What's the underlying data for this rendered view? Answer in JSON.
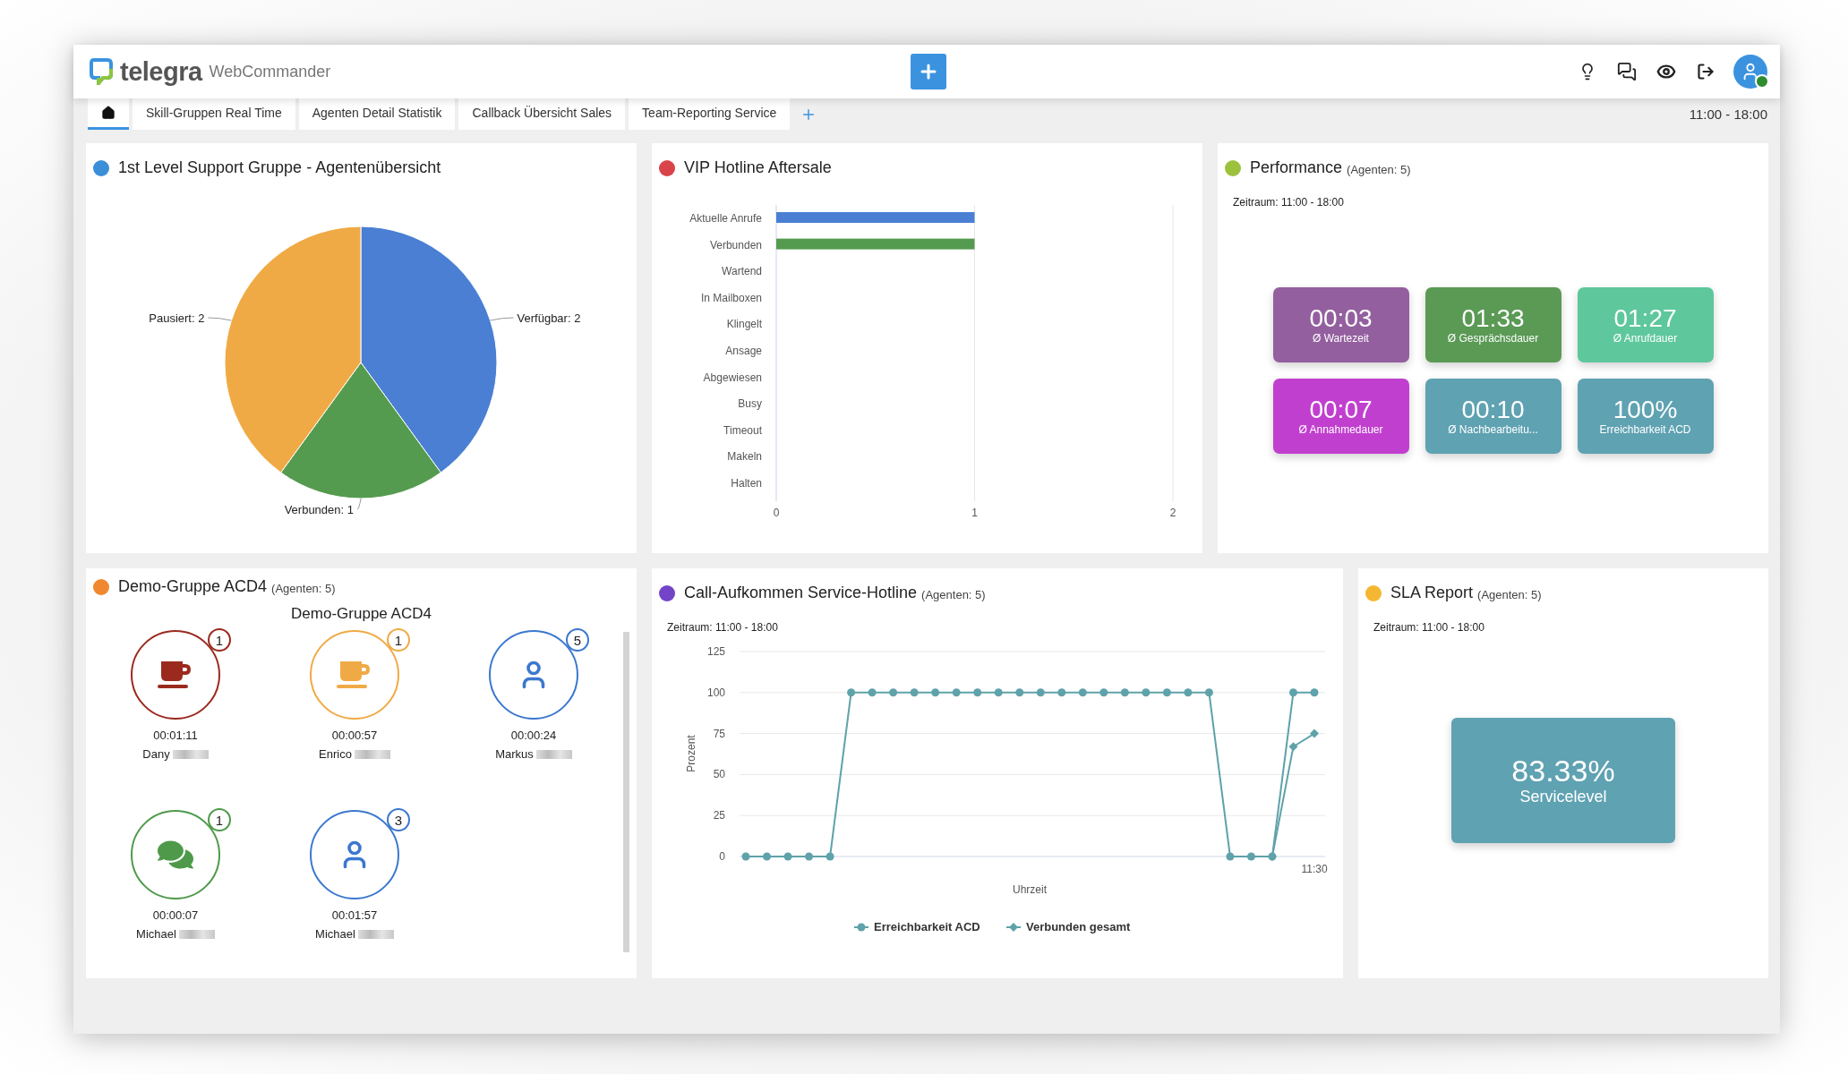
{
  "app": {
    "logo_text": "telegra",
    "product": "WebCommander"
  },
  "tabs": [
    {
      "kind": "home",
      "selected": true
    },
    {
      "kind": "text",
      "label": "Skill-Gruppen Real Time",
      "selected": false
    },
    {
      "kind": "text",
      "label": "Agenten Detail Statistik",
      "selected": false
    },
    {
      "kind": "text",
      "label": "Callback Übersicht Sales",
      "selected": false
    },
    {
      "kind": "text",
      "label": "Team-Reporting Service",
      "selected": false
    }
  ],
  "time_range": "11:00 - 18:00",
  "panels": [
    {
      "kind": "pie",
      "title": "1st Level Support Gruppe - Agentenübersicht",
      "color": "#3a8fd8",
      "chart_data": {
        "type": "pie",
        "categories": [
          "Verfügbar: 2",
          "Verbunden: 1",
          "Pausiert: 2"
        ],
        "values": [
          2,
          1,
          2
        ],
        "colors": [
          "#4a7fd4",
          "#559b4f",
          "#f0aa45"
        ]
      }
    },
    {
      "kind": "bar",
      "title": "VIP Hotline Aftersale",
      "color": "#d9434a",
      "chart_data": {
        "type": "bar",
        "orientation": "horizontal",
        "categories": [
          "Aktuelle Anrufe",
          "Verbunden",
          "Wartend",
          "In Mailboxen",
          "Klingelt",
          "Ansage",
          "Abgewiesen",
          "Busy",
          "Timeout",
          "Makeln",
          "Halten"
        ],
        "series": [
          {
            "color": "#4a7fd4",
            "values": [
              1,
              0,
              0,
              0,
              0,
              0,
              0,
              0,
              0,
              0,
              0
            ]
          },
          {
            "color": "#559b4f",
            "values": [
              0,
              1,
              0,
              0,
              0,
              0,
              0,
              0,
              0,
              0,
              0
            ]
          }
        ],
        "xlim": [
          0,
          2
        ],
        "xticks": [
          0,
          1,
          2
        ],
        "grid": true
      }
    },
    {
      "kind": "performance",
      "title": "Performance",
      "subtitle": "(Agenten: 5)",
      "color": "#9cc13c",
      "period": "Zeitraum: 11:00 - 18:00",
      "tiles": [
        {
          "value": "00:03",
          "label": "Ø Wartezeit",
          "color": "#945f9f"
        },
        {
          "value": "01:33",
          "label": "Ø Gesprächsdauer",
          "color": "#5a9a55"
        },
        {
          "value": "01:27",
          "label": "Ø Anrufdauer",
          "color": "#5ec79c"
        },
        {
          "value": "00:07",
          "label": "Ø Annahmedauer",
          "color": "#c13fcf"
        },
        {
          "value": "00:10",
          "label": "Ø Nachbearbeitu...",
          "color": "#5fa2b2"
        },
        {
          "value": "100%",
          "label": "Erreichbarkeit ACD",
          "color": "#5fa2b2"
        }
      ]
    },
    {
      "kind": "agents",
      "title": "Demo-Gruppe ACD4",
      "subtitle": "(Agenten: 5)",
      "color": "#f0882f",
      "group_heading": "Demo-Gruppe ACD4",
      "agent_rows": [
        {
          "agents": [
            {
              "kind": "cup",
              "color": "#9b2a1e",
              "count": "1",
              "time": "00:01:11",
              "name": "Dany"
            },
            {
              "kind": "cup",
              "color": "#f0aa45",
              "count": "1",
              "time": "00:00:57",
              "name": "Enrico"
            },
            {
              "kind": "person",
              "color": "#3b78cf",
              "count": "5",
              "time": "00:00:24",
              "name": "Markus"
            }
          ]
        },
        {
          "agents": [
            {
              "kind": "chat",
              "color": "#4e9a4a",
              "count": "1",
              "time": "00:00:07",
              "name": "Michael"
            },
            {
              "kind": "person",
              "color": "#3b78cf",
              "count": "3",
              "time": "00:01:57",
              "name": "Michael"
            }
          ]
        }
      ]
    },
    {
      "kind": "line",
      "title": "Call-Aufkommen Service-Hotline",
      "subtitle": "(Agenten: 5)",
      "color": "#7444c8",
      "period": "Zeitraum: 11:00 - 18:00",
      "time_label": "11:30",
      "chart_data": {
        "type": "line",
        "xlabel": "Uhrzeit",
        "ylabel": "Prozent",
        "ylim": [
          0,
          125
        ],
        "yticks": [
          0,
          25,
          50,
          75,
          100,
          125
        ],
        "grid": true,
        "legend": true,
        "series": [
          {
            "name": "Erreichbarkeit ACD",
            "color": "#5fa2aa",
            "marker": "circle",
            "values": [
              0,
              0,
              0,
              0,
              0,
              100,
              100,
              100,
              100,
              100,
              100,
              100,
              100,
              100,
              100,
              100,
              100,
              100,
              100,
              100,
              100,
              100,
              100,
              0,
              0,
              0,
              100,
              100
            ]
          },
          {
            "name": "Verbunden gesamt",
            "color": "#5fa2aa",
            "marker": "diamond",
            "values": [
              null,
              null,
              null,
              null,
              null,
              null,
              null,
              null,
              null,
              null,
              null,
              null,
              null,
              null,
              null,
              null,
              null,
              null,
              null,
              null,
              null,
              null,
              null,
              null,
              null,
              0,
              67,
              75
            ]
          }
        ]
      }
    },
    {
      "kind": "sla",
      "title": "SLA Report",
      "subtitle": "(Agenten: 5)",
      "color": "#f5b731",
      "period": "Zeitraum: 11:00 - 18:00",
      "tile": {
        "value": "83.33%",
        "label": "Servicelevel",
        "color": "#5fa2b2"
      }
    }
  ]
}
